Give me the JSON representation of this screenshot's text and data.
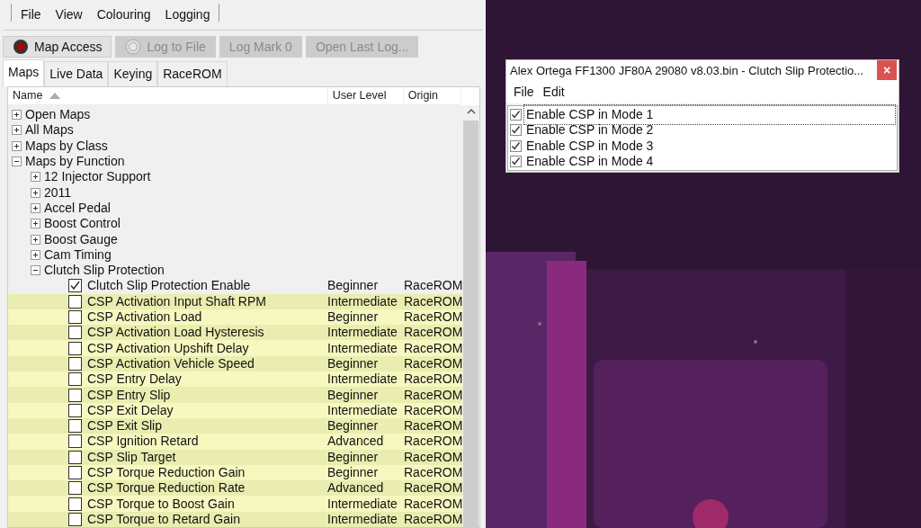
{
  "menu": [
    "File",
    "View",
    "Colouring",
    "Logging"
  ],
  "toolbar": [
    {
      "label": "Map Access",
      "kind": "record",
      "disabled": false
    },
    {
      "label": "Log to File",
      "kind": "record",
      "disabled": true
    },
    {
      "label": "Log Mark 0",
      "disabled": true
    },
    {
      "label": "Open Last Log...",
      "disabled": true
    }
  ],
  "tabs": [
    {
      "label": "Maps",
      "selected": true
    },
    {
      "label": "Live Data",
      "selected": false
    },
    {
      "label": "Keying",
      "selected": false
    },
    {
      "label": "RaceROM",
      "selected": false
    }
  ],
  "tree": {
    "columns": [
      {
        "label": "Name",
        "sorted": true
      },
      {
        "label": "User Level",
        "sorted": false
      },
      {
        "label": "Origin",
        "sorted": false
      }
    ],
    "items": [
      {
        "label": "Open Maps",
        "expanded": false
      },
      {
        "label": "All Maps",
        "expanded": false
      },
      {
        "label": "Maps by Class",
        "expanded": false
      },
      {
        "label": "Maps by Function",
        "expanded": true,
        "children": [
          {
            "label": "12 Injector Support",
            "expanded": false
          },
          {
            "label": "2011",
            "expanded": false
          },
          {
            "label": "Accel Pedal",
            "expanded": false
          },
          {
            "label": "Boost Control",
            "expanded": false
          },
          {
            "label": "Boost Gauge",
            "expanded": false
          },
          {
            "label": "Cam Timing",
            "expanded": false
          },
          {
            "label": "Clutch Slip Protection",
            "expanded": true,
            "children": [
              {
                "label": "Clutch Slip Protection Enable",
                "checked": true,
                "highlighted": false,
                "level": "Beginner",
                "origin": "RaceROM"
              },
              {
                "label": "CSP Activation Input Shaft RPM",
                "checked": false,
                "highlighted": true,
                "level": "Intermediate",
                "origin": "RaceROM"
              },
              {
                "label": "CSP Activation Load",
                "checked": false,
                "highlighted": true,
                "level": "Beginner",
                "origin": "RaceROM"
              },
              {
                "label": "CSP Activation Load Hysteresis",
                "checked": false,
                "highlighted": true,
                "level": "Intermediate",
                "origin": "RaceROM"
              },
              {
                "label": "CSP Activation Upshift Delay",
                "checked": false,
                "highlighted": true,
                "level": "Intermediate",
                "origin": "RaceROM"
              },
              {
                "label": "CSP Activation Vehicle Speed",
                "checked": false,
                "highlighted": true,
                "level": "Beginner",
                "origin": "RaceROM"
              },
              {
                "label": "CSP Entry Delay",
                "checked": false,
                "highlighted": true,
                "level": "Intermediate",
                "origin": "RaceROM"
              },
              {
                "label": "CSP Entry Slip",
                "checked": false,
                "highlighted": true,
                "level": "Beginner",
                "origin": "RaceROM"
              },
              {
                "label": "CSP Exit Delay",
                "checked": false,
                "highlighted": true,
                "level": "Intermediate",
                "origin": "RaceROM"
              },
              {
                "label": "CSP Exit Slip",
                "checked": false,
                "highlighted": true,
                "level": "Beginner",
                "origin": "RaceROM"
              },
              {
                "label": "CSP Ignition Retard",
                "checked": false,
                "highlighted": true,
                "level": "Advanced",
                "origin": "RaceROM"
              },
              {
                "label": "CSP Slip Target",
                "checked": false,
                "highlighted": true,
                "level": "Beginner",
                "origin": "RaceROM"
              },
              {
                "label": "CSP Torque Reduction Gain",
                "checked": false,
                "highlighted": true,
                "level": "Beginner",
                "origin": "RaceROM"
              },
              {
                "label": "CSP Torque Reduction Rate",
                "checked": false,
                "highlighted": true,
                "level": "Advanced",
                "origin": "RaceROM"
              },
              {
                "label": "CSP Torque to Boost Gain",
                "checked": false,
                "highlighted": true,
                "level": "Intermediate",
                "origin": "RaceROM"
              },
              {
                "label": "CSP Torque to Retard Gain",
                "checked": false,
                "highlighted": true,
                "level": "Intermediate",
                "origin": "RaceROM"
              }
            ]
          }
        ]
      }
    ]
  },
  "dialog": {
    "title": "Alex Ortega FF1300 JF80A 29080 v8.03.bin - Clutch Slip Protectio...",
    "close": "×",
    "menu": [
      "File",
      "Edit"
    ],
    "options": [
      {
        "label": "Enable CSP in Mode 1",
        "checked": true,
        "focused": true
      },
      {
        "label": "Enable CSP in Mode 2",
        "checked": true,
        "focused": false
      },
      {
        "label": "Enable CSP in Mode 3",
        "checked": true,
        "focused": false
      },
      {
        "label": "Enable CSP in Mode 4",
        "checked": true,
        "focused": false
      }
    ]
  }
}
